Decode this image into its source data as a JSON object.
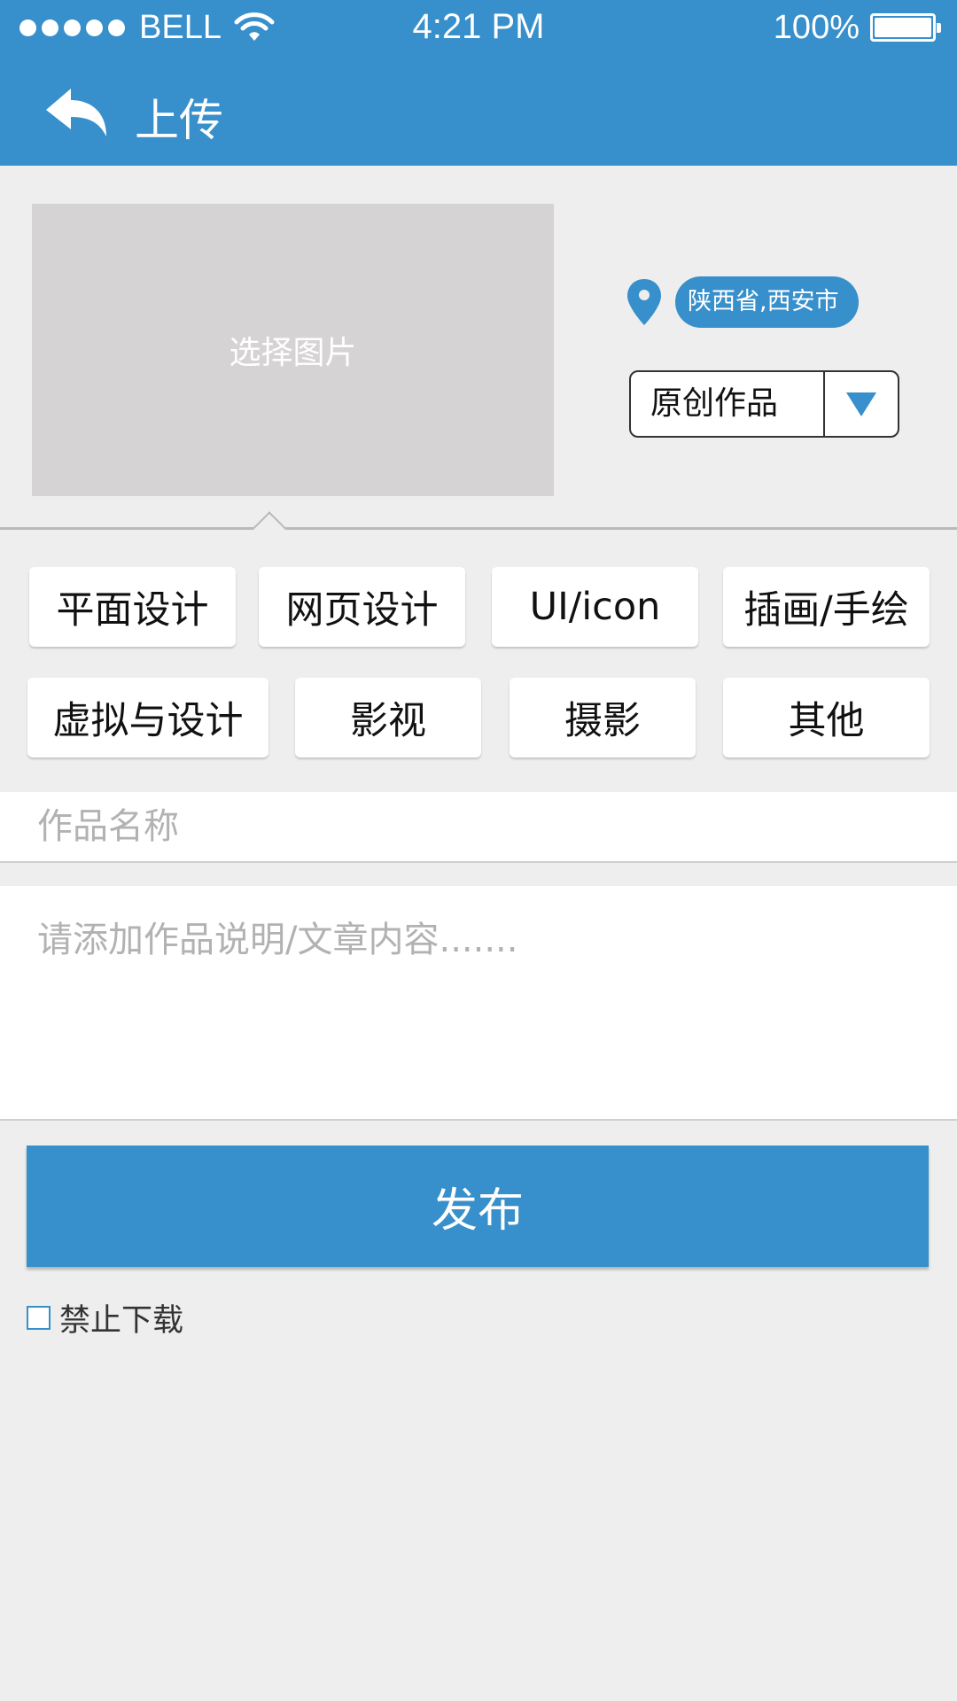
{
  "status_bar": {
    "carrier": "BELL",
    "time": "4:21 PM",
    "battery": "100%"
  },
  "nav": {
    "title": "上传",
    "back_icon": "back-arrow-icon"
  },
  "image_picker": {
    "label": "选择图片"
  },
  "location": {
    "icon": "map-pin-icon",
    "text": "陕西省,西安市"
  },
  "type_select": {
    "value": "原创作品",
    "icon": "triangle-down-icon"
  },
  "categories": {
    "row1": [
      "平面设计",
      "网页设计",
      "UI/icon",
      "插画/手绘"
    ],
    "row2": [
      "虚拟与设计",
      "影视",
      "摄影",
      "其他"
    ]
  },
  "name_field": {
    "placeholder": "作品名称"
  },
  "description_field": {
    "placeholder": "请添加作品说明/文章内容......."
  },
  "publish_button": {
    "label": "发布"
  },
  "no_download": {
    "label": "禁止下载",
    "checked": false
  },
  "colors": {
    "accent": "#378fcb",
    "background": "#eeeeee",
    "image_placeholder": "#d5d3d4"
  }
}
